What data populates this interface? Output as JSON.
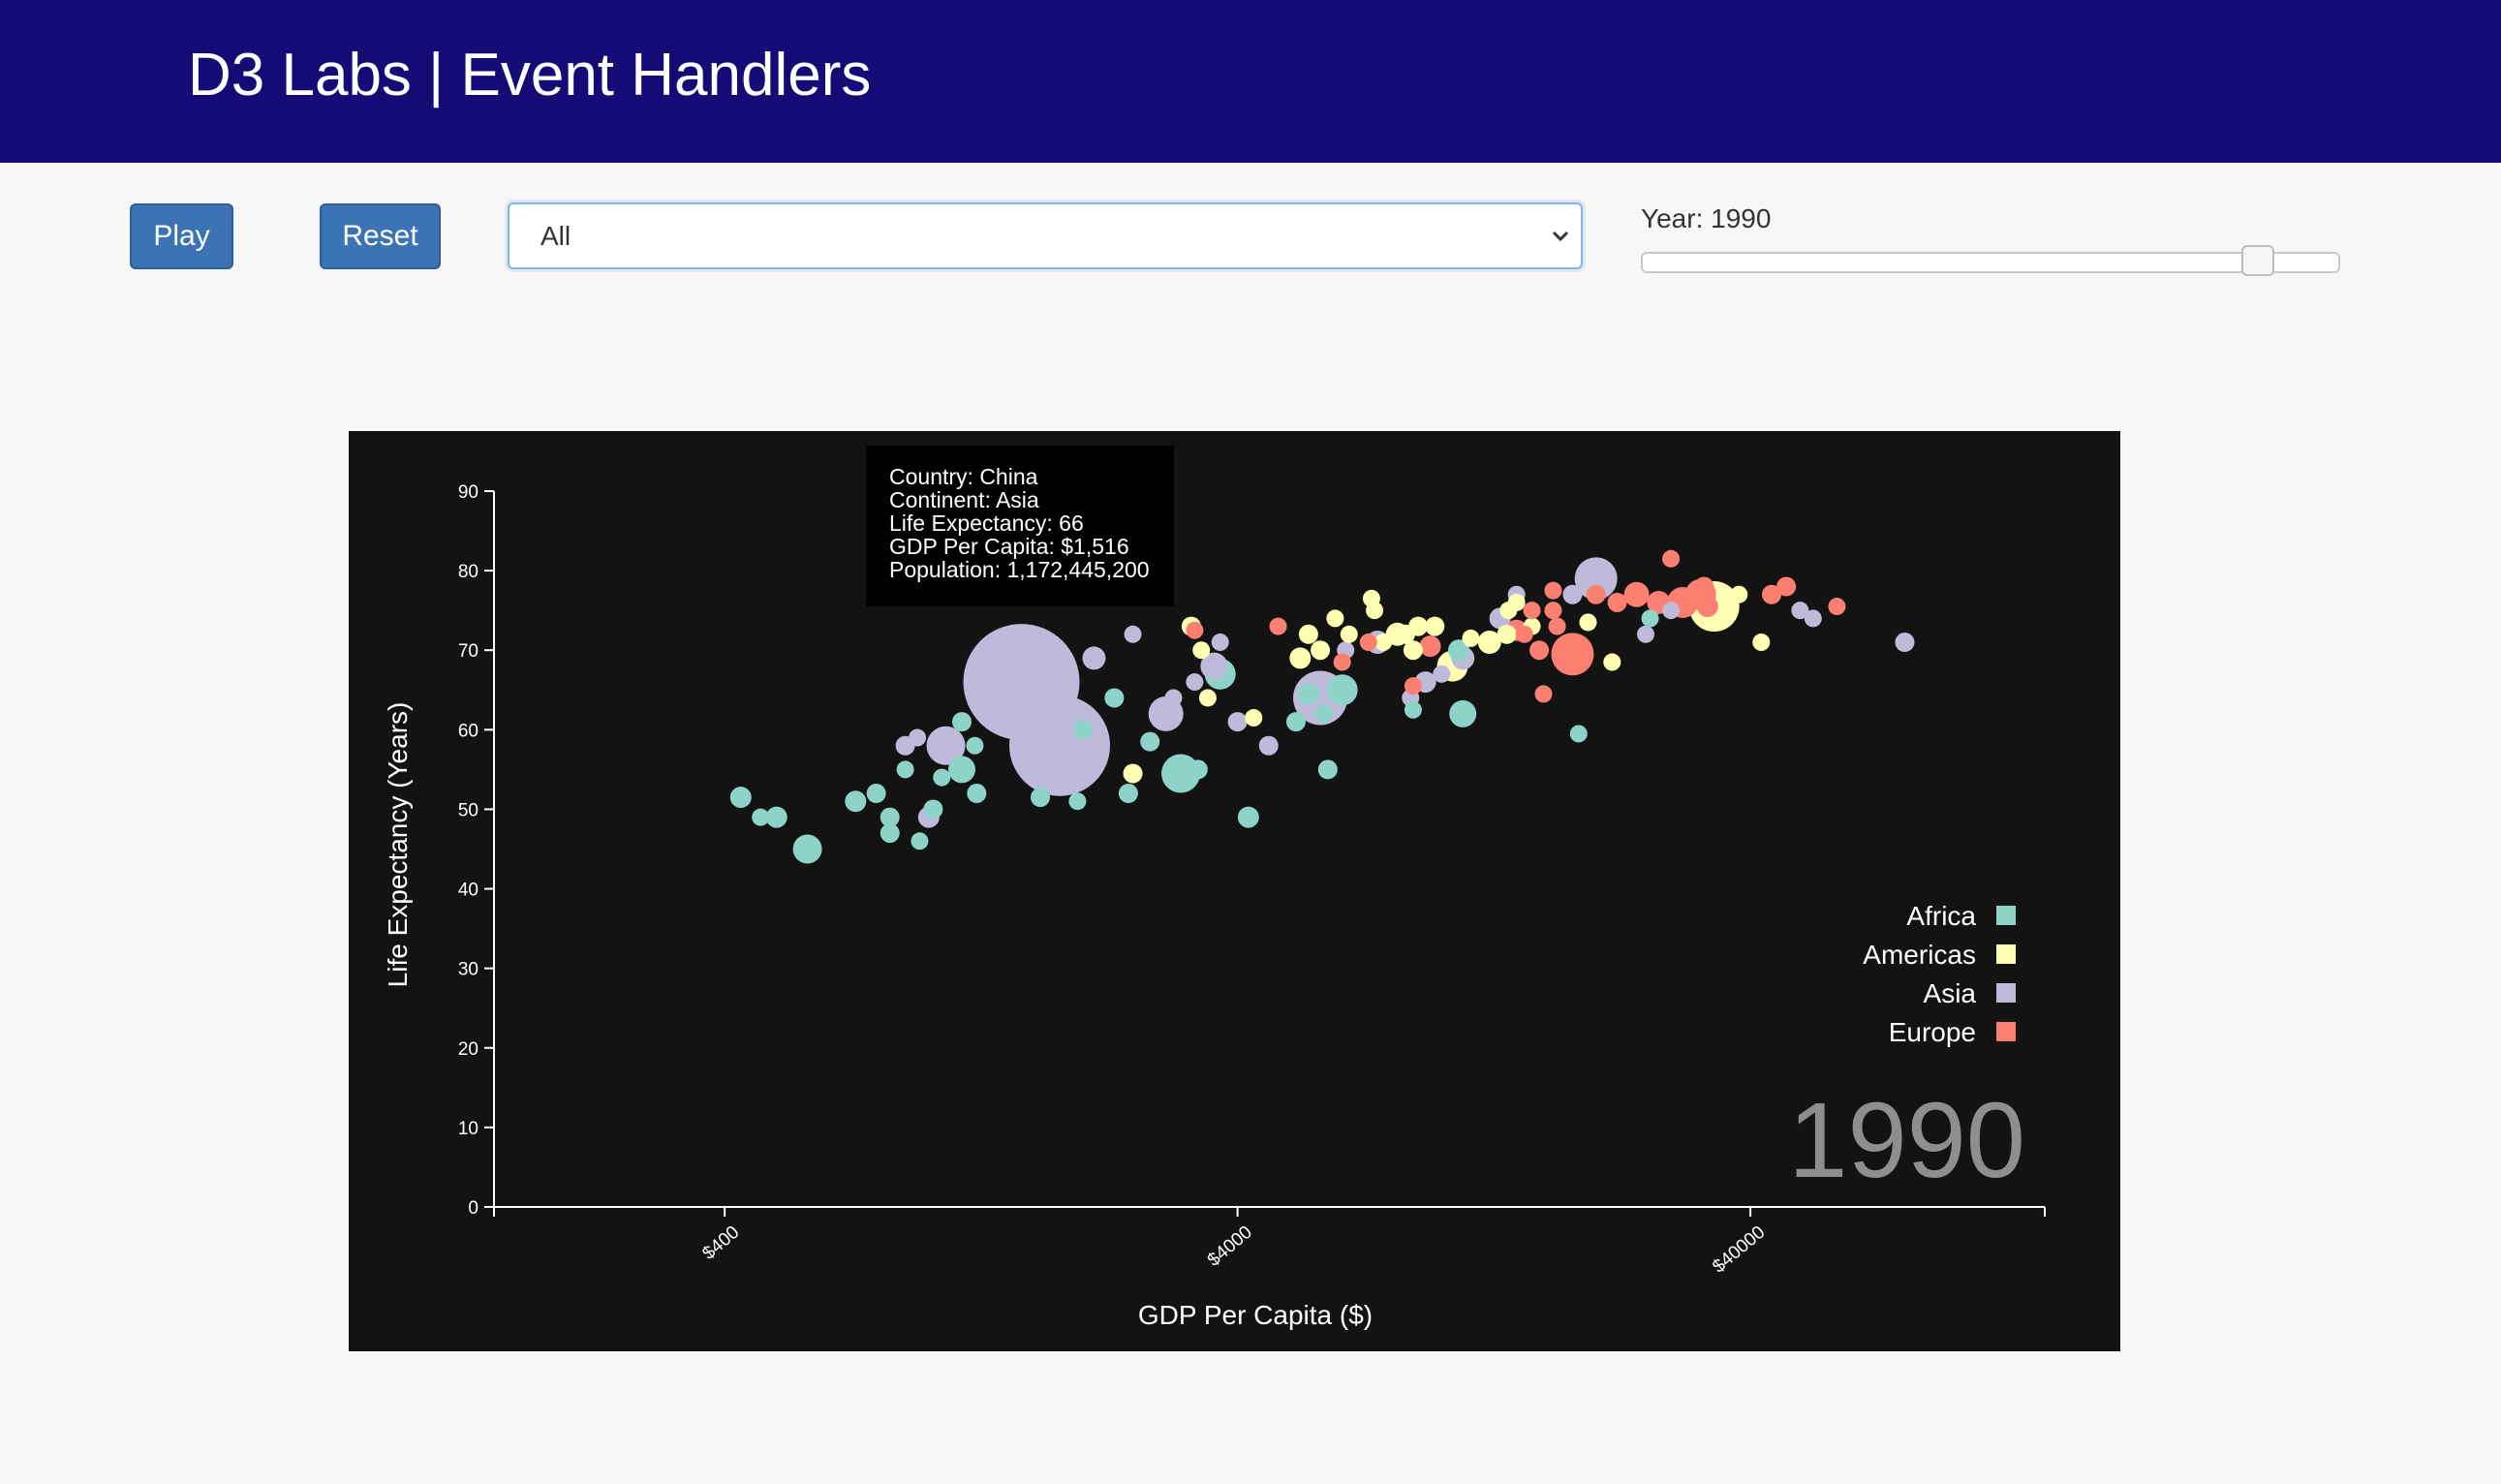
{
  "header": {
    "title": "D3 Labs | Event Handlers"
  },
  "controls": {
    "play_label": "Play",
    "reset_label": "Reset",
    "continent_select": {
      "value": "All"
    },
    "year_label": "Year: 1990",
    "year_slider": {
      "min": 1800,
      "max": 2014,
      "value": 1990
    }
  },
  "tooltip": {
    "country": "Country: China",
    "continent": "Continent: Asia",
    "life_exp": "Life Expectancy: 66",
    "gdp": "GDP Per Capita: $1,516",
    "population": "Population: 1,172,445,200"
  },
  "colors": {
    "Africa": "#8dd3c7",
    "Americas": "#ffffb3",
    "Asia": "#bebada",
    "Europe": "#fb8072",
    "background": "#131313",
    "header": "#140b77",
    "button": "#3b73b5"
  },
  "chart_data": {
    "type": "scatter",
    "xlabel": "GDP Per Capita ($)",
    "ylabel": "Life Expectancy (Years)",
    "x_scale": "log",
    "xlim": [
      142,
      150000
    ],
    "ylim": [
      0,
      90
    ],
    "x_ticks": [
      400,
      4000,
      40000
    ],
    "x_tick_labels": [
      "$400",
      "$4000",
      "$40000"
    ],
    "y_ticks": [
      0,
      10,
      20,
      30,
      40,
      50,
      60,
      70,
      80,
      90
    ],
    "year_watermark": "1990",
    "legend": {
      "placement": "right",
      "entries": [
        "Africa",
        "Americas",
        "Asia",
        "Europe"
      ]
    },
    "points": [
      {
        "c": "Asia",
        "x": 1516,
        "y": 66,
        "r": 60
      },
      {
        "c": "Asia",
        "x": 1800,
        "y": 58,
        "r": 52
      },
      {
        "c": "Asia",
        "x": 1080,
        "y": 58,
        "r": 20
      },
      {
        "c": "Asia",
        "x": 2900,
        "y": 62,
        "r": 18
      },
      {
        "c": "Asia",
        "x": 5800,
        "y": 64,
        "r": 28
      },
      {
        "c": "Asia",
        "x": 2500,
        "y": 72,
        "r": 9
      },
      {
        "c": "Asia",
        "x": 2100,
        "y": 69,
        "r": 12
      },
      {
        "c": "Asia",
        "x": 3600,
        "y": 68,
        "r": 14
      },
      {
        "c": "Asia",
        "x": 4000,
        "y": 61,
        "r": 10
      },
      {
        "c": "Asia",
        "x": 3000,
        "y": 64,
        "r": 9
      },
      {
        "c": "Asia",
        "x": 4600,
        "y": 58,
        "r": 10
      },
      {
        "c": "Asia",
        "x": 900,
        "y": 58,
        "r": 10
      },
      {
        "c": "Asia",
        "x": 950,
        "y": 59,
        "r": 9
      },
      {
        "c": "Asia",
        "x": 1000,
        "y": 49,
        "r": 11
      },
      {
        "c": "Asia",
        "x": 20000,
        "y": 79,
        "r": 22
      },
      {
        "c": "Asia",
        "x": 18000,
        "y": 77,
        "r": 10
      },
      {
        "c": "Asia",
        "x": 13000,
        "y": 74,
        "r": 11
      },
      {
        "c": "Asia",
        "x": 11000,
        "y": 69,
        "r": 12
      },
      {
        "c": "Asia",
        "x": 10000,
        "y": 67,
        "r": 9
      },
      {
        "c": "Asia",
        "x": 28000,
        "y": 75,
        "r": 9
      },
      {
        "c": "Asia",
        "x": 25000,
        "y": 72,
        "r": 9
      },
      {
        "c": "Asia",
        "x": 6500,
        "y": 70,
        "r": 9
      },
      {
        "c": "Asia",
        "x": 7500,
        "y": 71,
        "r": 12
      },
      {
        "c": "Asia",
        "x": 8700,
        "y": 64,
        "r": 9
      },
      {
        "c": "Asia",
        "x": 9300,
        "y": 66,
        "r": 11
      },
      {
        "c": "Asia",
        "x": 50000,
        "y": 75,
        "r": 9
      },
      {
        "c": "Asia",
        "x": 53000,
        "y": 74,
        "r": 9
      },
      {
        "c": "Asia",
        "x": 80000,
        "y": 71,
        "r": 10
      },
      {
        "c": "Asia",
        "x": 3300,
        "y": 66,
        "r": 9
      },
      {
        "c": "Asia",
        "x": 3700,
        "y": 71,
        "r": 9
      },
      {
        "c": "Asia",
        "x": 14000,
        "y": 77,
        "r": 9
      },
      {
        "c": "Africa",
        "x": 430,
        "y": 51.5,
        "r": 11
      },
      {
        "c": "Africa",
        "x": 470,
        "y": 49,
        "r": 9
      },
      {
        "c": "Africa",
        "x": 505,
        "y": 49,
        "r": 11
      },
      {
        "c": "Africa",
        "x": 580,
        "y": 45,
        "r": 15
      },
      {
        "c": "Africa",
        "x": 720,
        "y": 51,
        "r": 11
      },
      {
        "c": "Africa",
        "x": 790,
        "y": 52,
        "r": 10
      },
      {
        "c": "Africa",
        "x": 840,
        "y": 47,
        "r": 10
      },
      {
        "c": "Africa",
        "x": 840,
        "y": 49,
        "r": 10
      },
      {
        "c": "Africa",
        "x": 900,
        "y": 55,
        "r": 9
      },
      {
        "c": "Africa",
        "x": 960,
        "y": 46,
        "r": 9
      },
      {
        "c": "Africa",
        "x": 1020,
        "y": 50,
        "r": 10
      },
      {
        "c": "Africa",
        "x": 1060,
        "y": 54,
        "r": 9
      },
      {
        "c": "Africa",
        "x": 1160,
        "y": 55,
        "r": 14
      },
      {
        "c": "Africa",
        "x": 1240,
        "y": 52,
        "r": 10
      },
      {
        "c": "Africa",
        "x": 1230,
        "y": 58,
        "r": 9
      },
      {
        "c": "Africa",
        "x": 1160,
        "y": 61,
        "r": 10
      },
      {
        "c": "Africa",
        "x": 1650,
        "y": 51.5,
        "r": 10
      },
      {
        "c": "Africa",
        "x": 1950,
        "y": 51,
        "r": 9
      },
      {
        "c": "Africa",
        "x": 2000,
        "y": 60,
        "r": 10
      },
      {
        "c": "Africa",
        "x": 2300,
        "y": 64,
        "r": 10
      },
      {
        "c": "Africa",
        "x": 2450,
        "y": 52,
        "r": 10
      },
      {
        "c": "Africa",
        "x": 2700,
        "y": 58.5,
        "r": 10
      },
      {
        "c": "Africa",
        "x": 3100,
        "y": 54.5,
        "r": 20
      },
      {
        "c": "Africa",
        "x": 3350,
        "y": 55,
        "r": 10
      },
      {
        "c": "Africa",
        "x": 3700,
        "y": 67,
        "r": 16
      },
      {
        "c": "Africa",
        "x": 4200,
        "y": 49,
        "r": 11
      },
      {
        "c": "Africa",
        "x": 5200,
        "y": 61,
        "r": 10
      },
      {
        "c": "Africa",
        "x": 5500,
        "y": 64.5,
        "r": 11
      },
      {
        "c": "Africa",
        "x": 5900,
        "y": 62,
        "r": 9
      },
      {
        "c": "Africa",
        "x": 6000,
        "y": 55,
        "r": 10
      },
      {
        "c": "Africa",
        "x": 6400,
        "y": 65,
        "r": 16
      },
      {
        "c": "Africa",
        "x": 8800,
        "y": 62.5,
        "r": 9
      },
      {
        "c": "Africa",
        "x": 11000,
        "y": 62,
        "r": 14
      },
      {
        "c": "Africa",
        "x": 18500,
        "y": 59.5,
        "r": 9
      },
      {
        "c": "Africa",
        "x": 25500,
        "y": 74,
        "r": 9
      },
      {
        "c": "Africa",
        "x": 10800,
        "y": 70,
        "r": 11
      },
      {
        "c": "Americas",
        "x": 2500,
        "y": 54.5,
        "r": 10
      },
      {
        "c": "Americas",
        "x": 3250,
        "y": 73,
        "r": 10
      },
      {
        "c": "Americas",
        "x": 3400,
        "y": 70,
        "r": 9
      },
      {
        "c": "Americas",
        "x": 3500,
        "y": 64,
        "r": 9
      },
      {
        "c": "Americas",
        "x": 4300,
        "y": 61.5,
        "r": 9
      },
      {
        "c": "Americas",
        "x": 5300,
        "y": 69,
        "r": 11
      },
      {
        "c": "Americas",
        "x": 5500,
        "y": 72,
        "r": 10
      },
      {
        "c": "Americas",
        "x": 5800,
        "y": 70,
        "r": 10
      },
      {
        "c": "Americas",
        "x": 6200,
        "y": 74,
        "r": 9
      },
      {
        "c": "Americas",
        "x": 6600,
        "y": 72,
        "r": 9
      },
      {
        "c": "Americas",
        "x": 7400,
        "y": 75,
        "r": 9
      },
      {
        "c": "Americas",
        "x": 7700,
        "y": 71,
        "r": 9
      },
      {
        "c": "Americas",
        "x": 8200,
        "y": 72,
        "r": 12
      },
      {
        "c": "Americas",
        "x": 8500,
        "y": 72,
        "r": 10
      },
      {
        "c": "Americas",
        "x": 9000,
        "y": 73,
        "r": 10
      },
      {
        "c": "Americas",
        "x": 9700,
        "y": 73,
        "r": 10
      },
      {
        "c": "Americas",
        "x": 10500,
        "y": 68,
        "r": 16
      },
      {
        "c": "Americas",
        "x": 11400,
        "y": 71.5,
        "r": 9
      },
      {
        "c": "Americas",
        "x": 12400,
        "y": 71,
        "r": 12
      },
      {
        "c": "Americas",
        "x": 13400,
        "y": 72,
        "r": 10
      },
      {
        "c": "Americas",
        "x": 13500,
        "y": 75,
        "r": 9
      },
      {
        "c": "Americas",
        "x": 15000,
        "y": 73,
        "r": 9
      },
      {
        "c": "Americas",
        "x": 19300,
        "y": 73.5,
        "r": 9
      },
      {
        "c": "Americas",
        "x": 21500,
        "y": 68.5,
        "r": 9
      },
      {
        "c": "Americas",
        "x": 34000,
        "y": 75.5,
        "r": 26
      },
      {
        "c": "Americas",
        "x": 38000,
        "y": 77,
        "r": 9
      },
      {
        "c": "Americas",
        "x": 42000,
        "y": 71,
        "r": 9
      },
      {
        "c": "Americas",
        "x": 7300,
        "y": 76.5,
        "r": 9
      },
      {
        "c": "Americas",
        "x": 8800,
        "y": 70,
        "r": 10
      },
      {
        "c": "Americas",
        "x": 14000,
        "y": 76,
        "r": 9
      },
      {
        "c": "Europe",
        "x": 3300,
        "y": 72.5,
        "r": 9
      },
      {
        "c": "Europe",
        "x": 4800,
        "y": 73,
        "r": 9
      },
      {
        "c": "Europe",
        "x": 6400,
        "y": 68.5,
        "r": 9
      },
      {
        "c": "Europe",
        "x": 7200,
        "y": 71,
        "r": 9
      },
      {
        "c": "Europe",
        "x": 8800,
        "y": 65.5,
        "r": 9
      },
      {
        "c": "Europe",
        "x": 9500,
        "y": 70.5,
        "r": 11
      },
      {
        "c": "Europe",
        "x": 14000,
        "y": 72.5,
        "r": 11
      },
      {
        "c": "Europe",
        "x": 14500,
        "y": 72,
        "r": 9
      },
      {
        "c": "Europe",
        "x": 15500,
        "y": 70,
        "r": 10
      },
      {
        "c": "Europe",
        "x": 15800,
        "y": 64.5,
        "r": 9
      },
      {
        "c": "Europe",
        "x": 16500,
        "y": 75,
        "r": 9
      },
      {
        "c": "Europe",
        "x": 16800,
        "y": 73,
        "r": 9
      },
      {
        "c": "Europe",
        "x": 18000,
        "y": 69.5,
        "r": 22
      },
      {
        "c": "Europe",
        "x": 20000,
        "y": 77,
        "r": 10
      },
      {
        "c": "Europe",
        "x": 22000,
        "y": 76,
        "r": 10
      },
      {
        "c": "Europe",
        "x": 24000,
        "y": 77,
        "r": 13
      },
      {
        "c": "Europe",
        "x": 26500,
        "y": 76,
        "r": 12
      },
      {
        "c": "Europe",
        "x": 28000,
        "y": 81.5,
        "r": 9
      },
      {
        "c": "Europe",
        "x": 29500,
        "y": 76,
        "r": 16
      },
      {
        "c": "Europe",
        "x": 32000,
        "y": 77,
        "r": 16
      },
      {
        "c": "Europe",
        "x": 32500,
        "y": 78,
        "r": 10
      },
      {
        "c": "Europe",
        "x": 33000,
        "y": 75.5,
        "r": 11
      },
      {
        "c": "Europe",
        "x": 44000,
        "y": 77,
        "r": 10
      },
      {
        "c": "Europe",
        "x": 47000,
        "y": 78,
        "r": 10
      },
      {
        "c": "Europe",
        "x": 59000,
        "y": 75.5,
        "r": 9
      },
      {
        "c": "Europe",
        "x": 16500,
        "y": 77.5,
        "r": 9
      },
      {
        "c": "Europe",
        "x": 15000,
        "y": 75,
        "r": 9
      }
    ]
  }
}
